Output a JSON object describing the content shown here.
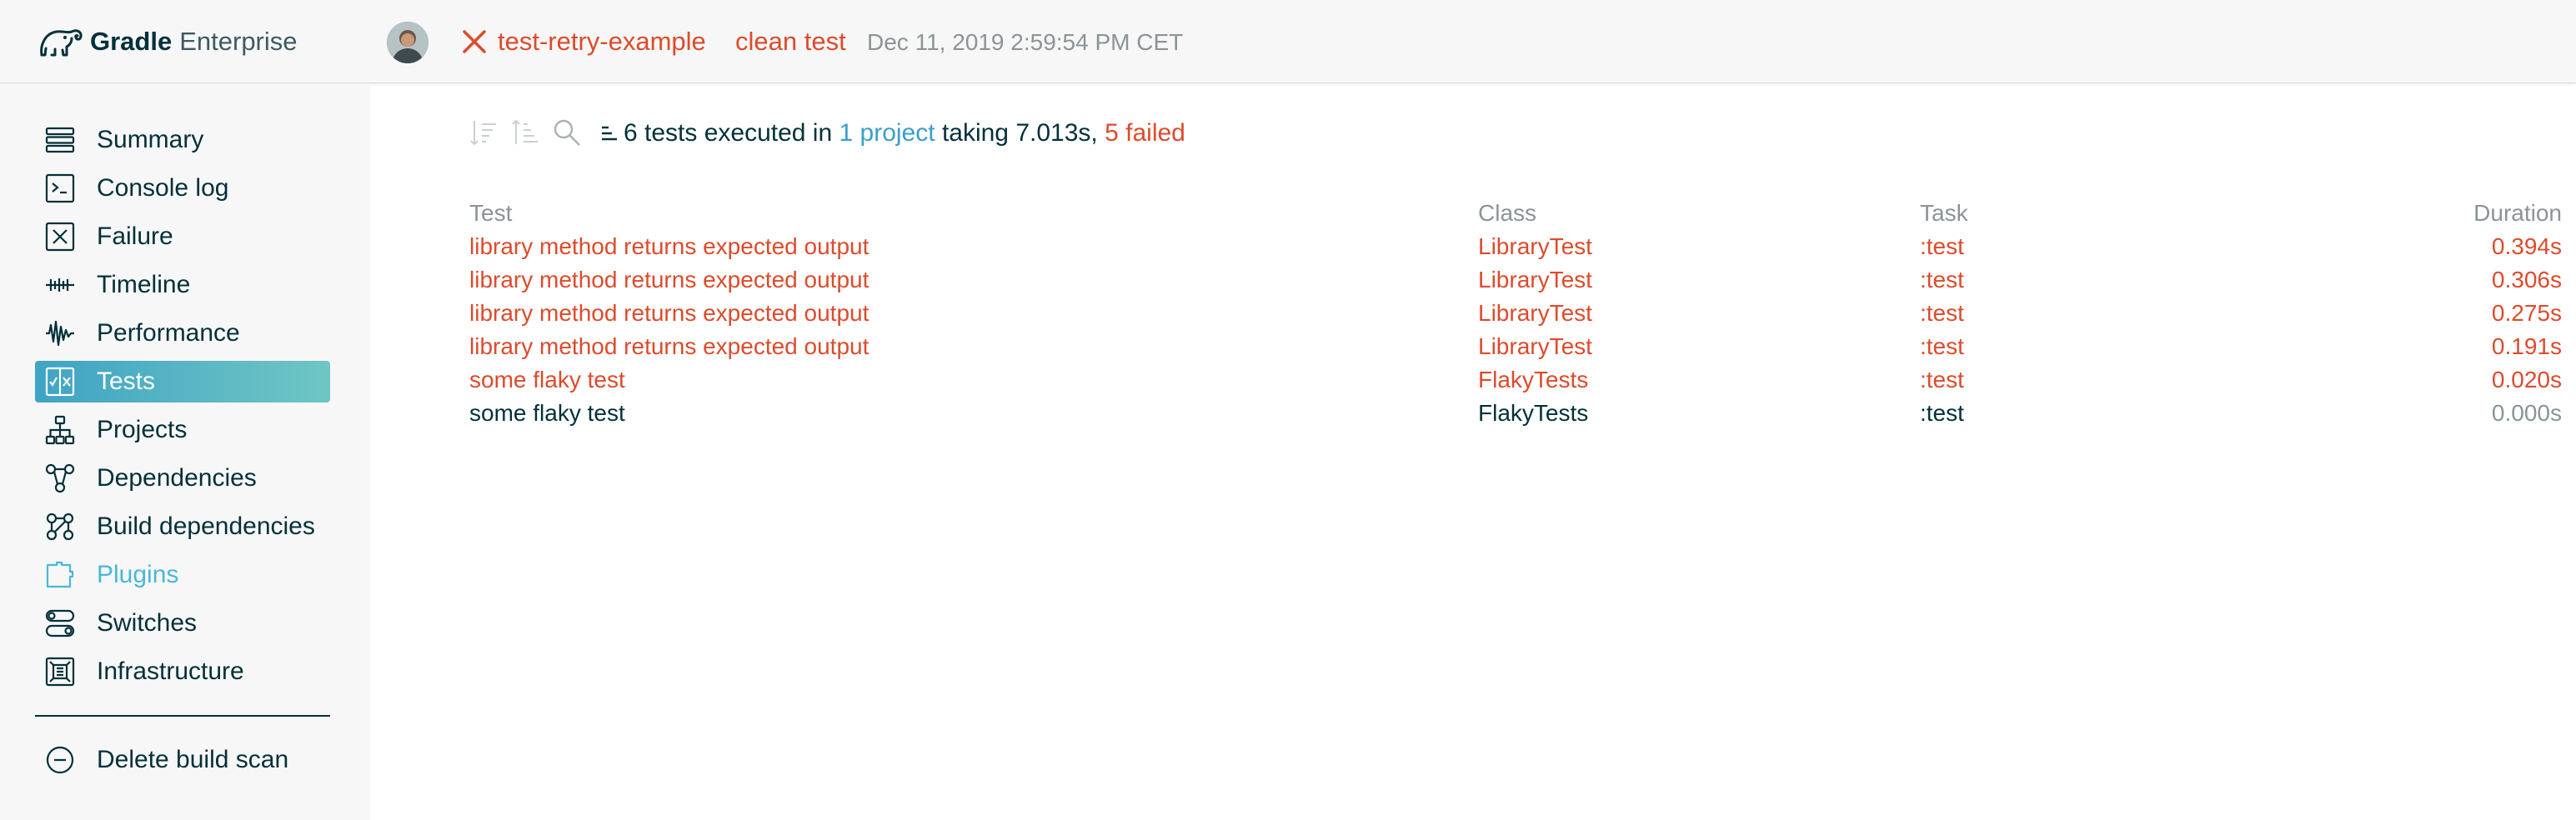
{
  "header": {
    "logo_strong": "Gradle",
    "logo_light": "Enterprise",
    "project_name": "test-retry-example",
    "tasks": "clean test",
    "timestamp": "Dec 11, 2019 2:59:54 PM CET",
    "status": "failed"
  },
  "sidebar": {
    "items": [
      {
        "label": "Summary",
        "icon": "summary-icon"
      },
      {
        "label": "Console log",
        "icon": "console-icon"
      },
      {
        "label": "Failure",
        "icon": "failure-icon"
      },
      {
        "label": "Timeline",
        "icon": "timeline-icon"
      },
      {
        "label": "Performance",
        "icon": "performance-icon"
      },
      {
        "label": "Tests",
        "icon": "tests-icon",
        "active": true
      },
      {
        "label": "Projects",
        "icon": "projects-icon"
      },
      {
        "label": "Dependencies",
        "icon": "dependencies-icon"
      },
      {
        "label": "Build dependencies",
        "icon": "build-dependencies-icon"
      },
      {
        "label": "Plugins",
        "icon": "plugins-icon"
      },
      {
        "label": "Switches",
        "icon": "switches-icon"
      },
      {
        "label": "Infrastructure",
        "icon": "infrastructure-icon"
      }
    ],
    "delete_label": "Delete build scan"
  },
  "summary": {
    "count_text": "6 tests",
    "executed_in": "executed in",
    "project_link": "1 project",
    "taking": "taking",
    "duration": "7.013s,",
    "failed": "5 failed"
  },
  "table": {
    "headers": {
      "test": "Test",
      "class": "Class",
      "task": "Task",
      "duration": "Duration"
    },
    "rows": [
      {
        "test": "library method returns expected output",
        "class": "LibraryTest",
        "task": ":test",
        "duration": "0.394s",
        "status": "failed"
      },
      {
        "test": "library method returns expected output",
        "class": "LibraryTest",
        "task": ":test",
        "duration": "0.306s",
        "status": "failed"
      },
      {
        "test": "library method returns expected output",
        "class": "LibraryTest",
        "task": ":test",
        "duration": "0.275s",
        "status": "failed"
      },
      {
        "test": "library method returns expected output",
        "class": "LibraryTest",
        "task": ":test",
        "duration": "0.191s",
        "status": "failed"
      },
      {
        "test": "some flaky test",
        "class": "FlakyTests",
        "task": ":test",
        "duration": "0.020s",
        "status": "failed"
      },
      {
        "test": "some flaky test",
        "class": "FlakyTests",
        "task": ":test",
        "duration": "0.000s",
        "status": "passed"
      }
    ]
  },
  "colors": {
    "failed": "#dd4b2b",
    "link": "#3a9fc8",
    "text": "#02303a",
    "muted": "#8a9497",
    "active_start": "#3fa3c4",
    "active_end": "#6fc6c4"
  }
}
